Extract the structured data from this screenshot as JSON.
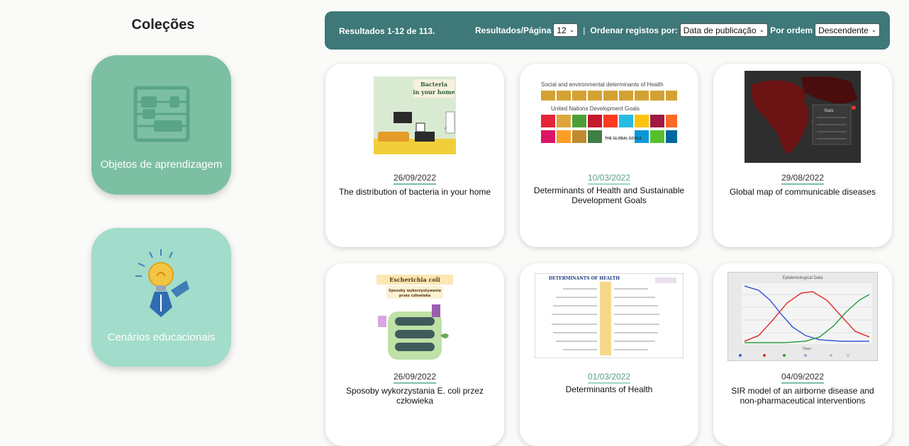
{
  "sidebar": {
    "title": "Coleções",
    "collections": [
      {
        "label": "Objetos de aprendizagem",
        "icon": "abacus-icon",
        "color": "#7cbfa3"
      },
      {
        "label": "Cenários educacionais",
        "icon": "lightbulb-pen-icon",
        "color": "#a2dccb"
      }
    ]
  },
  "toolbar": {
    "results_text": "Resultados 1-12 de 113.",
    "per_page_label": "Resultados/Página",
    "per_page_value": "12",
    "separator": "|",
    "sort_label": "Ordenar registos por:",
    "sort_value": "Data de publicação",
    "order_label": "Por ordem",
    "order_value": "Descendente",
    "color": "#3e7878"
  },
  "cards": [
    {
      "date": "26/09/2022",
      "title": "The distribution of bacteria in your home",
      "thumb_caption": "Bacteria in your home"
    },
    {
      "date": "10/03/2022",
      "title": "Determinants of Health and Sustainable Development Goals",
      "thumb_caption": "Social and environmental determinants of Health",
      "thumb_caption2": "United Nations Development Goals",
      "thumb_caption3": "THE GLOBAL GOALS"
    },
    {
      "date": "29/08/2022",
      "title": "Global map of communicable diseases",
      "thumb_caption": "Stats"
    },
    {
      "date": "26/09/2022",
      "title": "Sposoby wykorzystania E. coli przez człowieka",
      "thumb_caption": "Escherichia coli",
      "thumb_caption2": "Sposoby wykorzystywania przez człowieka"
    },
    {
      "date": "01/03/2022",
      "title": "Determinants of Health",
      "thumb_caption": "DETERMINANTS OF HEALTH"
    },
    {
      "date": "04/09/2022",
      "title": "SIR model of an airborne disease and non-pharmaceutical interventions",
      "thumb_caption": "Epidemiological Data",
      "thumb_caption2": "Days"
    }
  ]
}
